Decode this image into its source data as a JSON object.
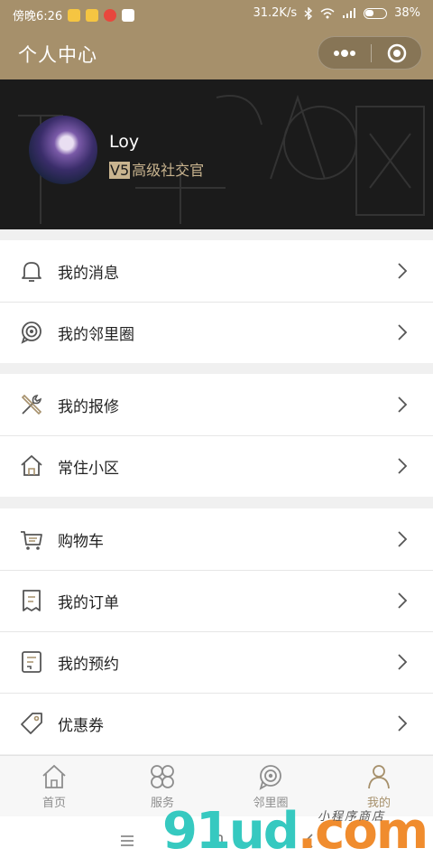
{
  "status_bar": {
    "time": "傍晚6:26",
    "network_speed": "31.2K/s",
    "battery": "38%"
  },
  "header": {
    "title": "个人中心"
  },
  "profile": {
    "name": "Loy",
    "level_badge": "V5",
    "level_title": "高级社交官"
  },
  "menu_groups": [
    {
      "items": [
        {
          "label": "我的消息",
          "icon": "bell-icon"
        },
        {
          "label": "我的邻里圈",
          "icon": "neighborhood-circle-icon"
        }
      ]
    },
    {
      "items": [
        {
          "label": "我的报修",
          "icon": "repair-tools-icon"
        },
        {
          "label": "常住小区",
          "icon": "house-icon"
        }
      ]
    },
    {
      "items": [
        {
          "label": "购物车",
          "icon": "shopping-cart-icon"
        },
        {
          "label": "我的订单",
          "icon": "order-receipt-icon"
        },
        {
          "label": "我的预约",
          "icon": "appointment-icon"
        },
        {
          "label": "优惠券",
          "icon": "coupon-tag-icon"
        }
      ]
    }
  ],
  "tabs": [
    {
      "label": "首页",
      "icon": "home-icon",
      "active": false
    },
    {
      "label": "服务",
      "icon": "services-icon",
      "active": false
    },
    {
      "label": "邻里圈",
      "icon": "neighborhood-circle-icon",
      "active": false
    },
    {
      "label": "我的",
      "icon": "person-icon",
      "active": true
    }
  ],
  "watermark": {
    "brand_main": "91ud",
    "brand_suffix": ".com",
    "brand_tagline": "小程序商店"
  },
  "colors": {
    "accent_gold": "#a6906b",
    "banner_dark": "#1b1b1b",
    "level_gold": "#c9b48f"
  }
}
